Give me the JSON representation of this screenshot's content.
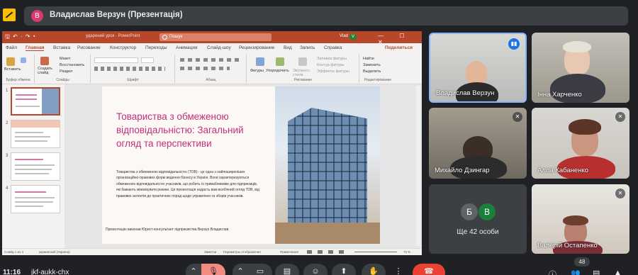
{
  "banner": {
    "avatar_letter": "В",
    "presenter": "Владислав Верзун (Презентація)"
  },
  "ppt": {
    "quick_access": "🖫 ↶ · ↷ ▾",
    "doc_title": "ударений урок · PowerPoint",
    "search_placeholder": "Пошук",
    "user": "Vlad",
    "user_initial": "V",
    "window_controls": "— ☐ ✕",
    "tabs": [
      "Файл",
      "Главная",
      "Вставка",
      "Рисование",
      "Конструктор",
      "Переходы",
      "Анимация",
      "Слайд-шоу",
      "Рецензирование",
      "Вид",
      "Запись",
      "Справка"
    ],
    "active_tab": "Главная",
    "share": "Поделиться",
    "ribbon": {
      "paste": "Вставить",
      "clipboard": "Буфер обмена",
      "new_slide": "Создать слайд",
      "layout": "Макет",
      "reset": "Восстановить",
      "sections": "Раздел",
      "slides": "Слайды",
      "font": "Шрифт",
      "paragraph": "Абзац",
      "shapes": "Фигуры",
      "arrange": "Упорядочить",
      "quick_styles": "Экспресс-стили",
      "fill": "Заливка фигуры",
      "outline": "Контур фигуры",
      "effects": "Эффекты фигуры",
      "drawing": "Рисование",
      "find": "Найти",
      "replace": "Заменить",
      "select": "Выделить",
      "editing": "Редактирование"
    },
    "thumb_numbers": [
      "1",
      "2",
      "3",
      "4"
    ],
    "slide": {
      "title": "Товариства з обмеженою відповідальністю: Загальний огляд та перспективи",
      "body": "Товариства з обмеженою відповідальністю (ТОВ) - це одна з найпоширеніших організаційно-правових форм ведення бізнесу в Україні. Вони характеризуються обмеженою відповідальністю учасників, що робить їх привабливими для підприємців, які бажають мінімізувати ризики. Ця презентація надасть вам всебічний огляд ТОВ, від правових аспектів до практичних порад щодо управління та зборів учасників.",
      "footer": "Презентацію виконав Юрист-консультант підприємства Верзун Владислав"
    },
    "status": {
      "slide_count": "Слайд 1 из 4",
      "language": "украинский (Україна)",
      "notes": "Заметки",
      "display": "Параметры отображения",
      "comments": "Примечания",
      "zoom": "72 %"
    }
  },
  "participants": [
    {
      "name": "Владислав Верзун",
      "state": "speaking"
    },
    {
      "name": "Інна Харченко",
      "state": "normal"
    },
    {
      "name": "Михайло Дзингар",
      "state": "muted"
    },
    {
      "name": "Алла Кабаненко",
      "state": "muted"
    },
    {
      "name": "Валерій Остапенко",
      "state": "muted"
    }
  ],
  "more": {
    "letters": [
      "Б",
      "В"
    ],
    "label": "Ще 42 особи"
  },
  "bottom": {
    "time": "11:16",
    "code": "jkf-aukk-chx",
    "participant_count": "48"
  }
}
